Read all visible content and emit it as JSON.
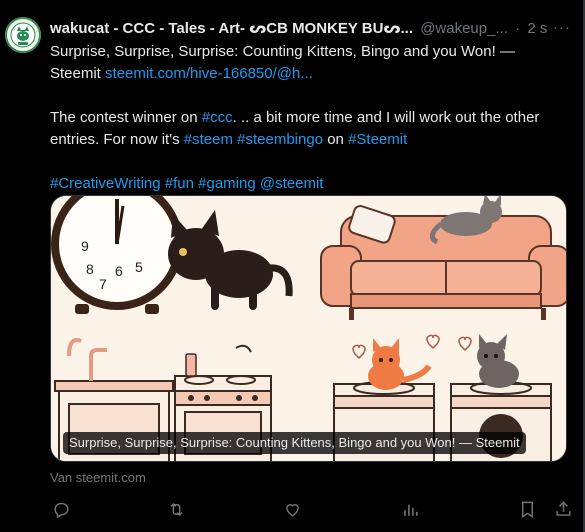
{
  "tweet": {
    "author_name": "wakucat - CCC - Tales - Art- ᔕCB MONKEY BUᔕ...",
    "handle": "@wakeup_...",
    "separator": "·",
    "time": "2 s",
    "more_label": "···",
    "line1_text": "Surprise, Surprise, Surprise: Counting Kittens, Bingo and you Won! —",
    "line2_prefix": "Steemit ",
    "line2_link": "steemit.com/hive-166850/@h...",
    "para2_a": "The contest winner on ",
    "para2_ccc": "#ccc",
    "para2_b": ". .. a bit more time and I will work out the other entries. For now it's ",
    "para2_steem": "#steem",
    "para2_space": " ",
    "para2_bingo": "#steembingo",
    "para2_on": " on ",
    "para2_steemit": "#Steemit",
    "tag_creative": "#CreativeWriting",
    "tag_fun": "#fun",
    "tag_gaming": "#gaming",
    "mention_steemit": "@steemit"
  },
  "card": {
    "caption": "Surprise, Surprise, Surprise: Counting Kittens, Bingo and you Won! — Steemit",
    "source": "Van steemit.com",
    "clock_numbers": [
      "9",
      "8",
      "7",
      "6",
      "5"
    ]
  },
  "colors": {
    "background": "#000000",
    "text": "#e7e9ea",
    "muted": "#71767b",
    "link": "#1d9bf0",
    "border": "#2f3336"
  },
  "actions": [
    {
      "name": "reply-icon"
    },
    {
      "name": "repost-icon"
    },
    {
      "name": "like-icon"
    },
    {
      "name": "views-icon"
    },
    {
      "name": "bookmark-icon"
    },
    {
      "name": "share-icon"
    }
  ]
}
